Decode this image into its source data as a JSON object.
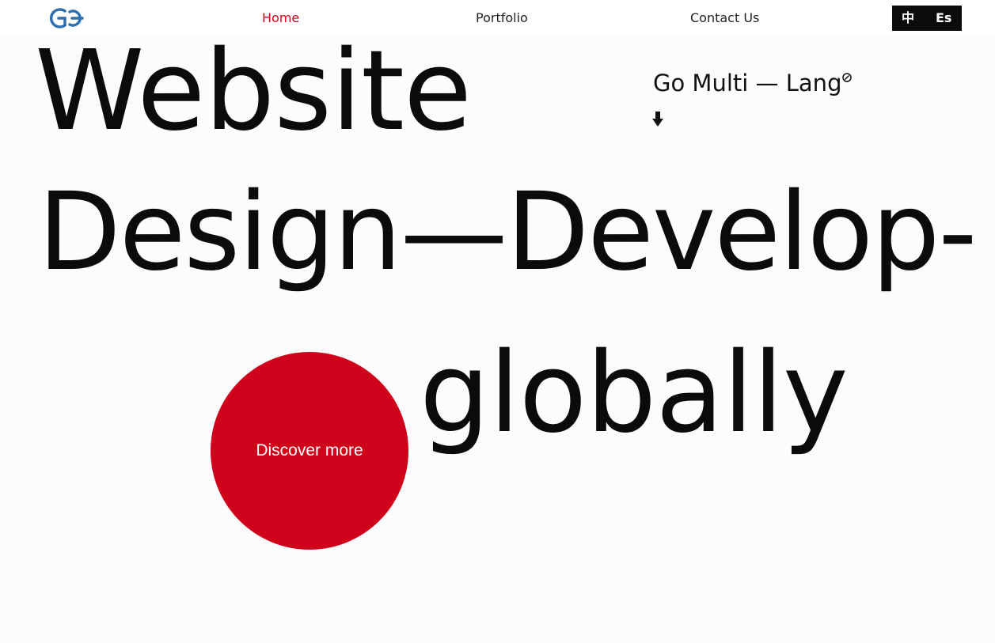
{
  "nav": {
    "home": "Home",
    "portfolio": "Portfolio",
    "contact": "Contact Us",
    "active": "home"
  },
  "lang": {
    "zh": "中",
    "es": "Es"
  },
  "hero": {
    "line1": "Website",
    "line2": "Design—Develop-",
    "line3": "globally",
    "tagline": "Go Multi — Lang",
    "cta": "Discover more"
  },
  "colors": {
    "accent": "#d0021b",
    "text": "#0b0b0b",
    "logo": "#2f6fb0"
  },
  "icons": {
    "logo": "go-logo",
    "tag": "compass-icon",
    "arrow": "arrow-down-icon"
  }
}
